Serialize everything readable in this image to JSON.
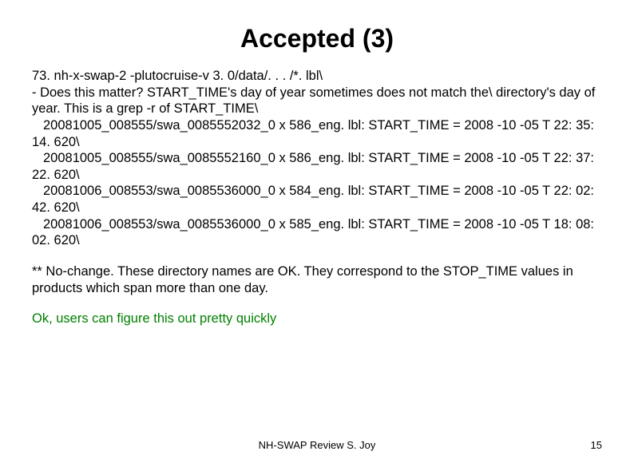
{
  "title": "Accepted (3)",
  "body": {
    "line1": "73. nh-x-swap-2 -plutocruise-v 3. 0/data/. . . /*. lbl\\",
    "line2": "- Does this matter? START_TIME's day of year sometimes does not match the\\ directory's day of year. This is a grep -r of START_TIME\\",
    "entry1": "20081005_008555/swa_0085552032_0 x 586_eng. lbl: START_TIME = 2008 -10 -05 T 22: 35: 14. 620\\",
    "entry2": "20081005_008555/swa_0085552160_0 x 586_eng. lbl: START_TIME = 2008 -10 -05 T 22: 37: 22. 620\\",
    "entry3": "20081006_008553/swa_0085536000_0 x 584_eng. lbl: START_TIME = 2008 -10 -05 T 22: 02: 42. 620\\",
    "entry4": "20081006_008553/swa_0085536000_0 x 585_eng. lbl: START_TIME = 2008 -10 -05 T 18: 08: 02. 620\\",
    "response": "** No-change. These directory names are OK. They correspond to the STOP_TIME values in products which span more than one day.",
    "note": "Ok, users can figure this out pretty quickly"
  },
  "footer": "NH-SWAP Review S. Joy",
  "page": "15"
}
